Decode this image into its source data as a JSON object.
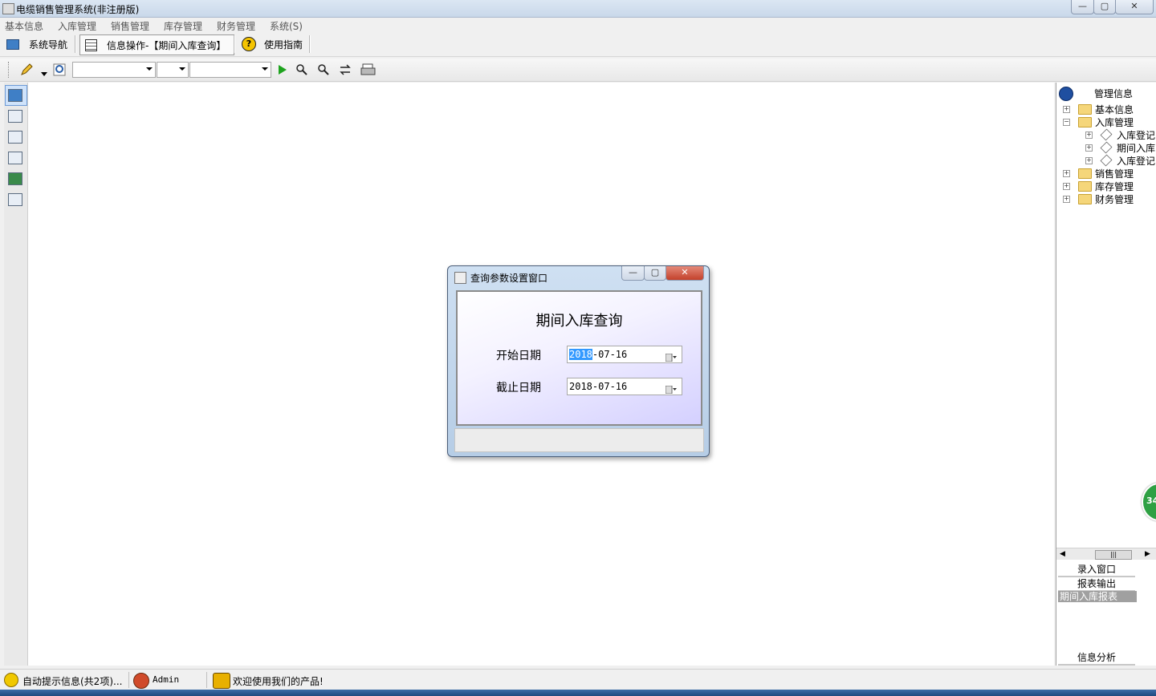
{
  "window": {
    "title": "电缆销售管理系统(非注册版)",
    "min": "—",
    "max": "▢",
    "close": "✕"
  },
  "menu": [
    "基本信息",
    "入库管理",
    "销售管理",
    "库存管理",
    "财务管理",
    "系统(S)"
  ],
  "tabs": {
    "nav": "系统导航",
    "info": "信息操作-【期间入库查询】",
    "guide": "使用指南"
  },
  "sidepanel": {
    "title": "管理信息",
    "tree": {
      "basic": "基本信息",
      "inbound": "入库管理",
      "inbound_children": [
        "入库登记",
        "期间入库",
        "入库登记"
      ],
      "sales": "销售管理",
      "stock": "库存管理",
      "finance": "财务管理"
    },
    "scroll_thumb": "|||",
    "buttons": {
      "entry": "录入窗口",
      "report": "报表输出",
      "selected": "期间入库报表",
      "analysis": "信息分析"
    }
  },
  "dialog": {
    "title": "查询参数设置窗口",
    "heading": "期间入库查询",
    "start_label": "开始日期",
    "start_year": "2018",
    "start_rest": "-07-16",
    "end_label": "截止日期",
    "end_value": "2018-07-16"
  },
  "status": {
    "info": "自动提示信息(共2项)...",
    "user": "Admin",
    "welcome": "欢迎使用我们的产品!"
  },
  "badge": "34"
}
